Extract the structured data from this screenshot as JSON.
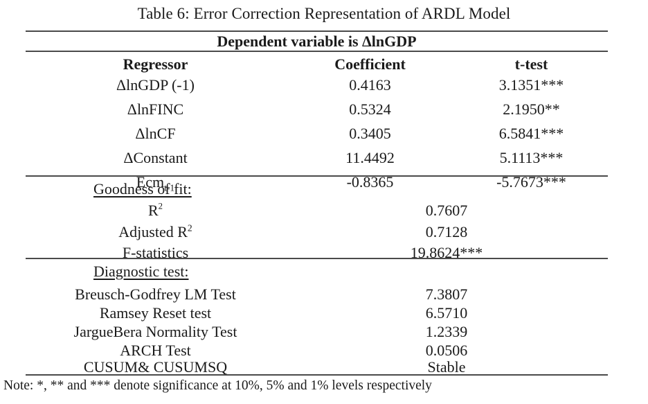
{
  "title": "Table 6: Error Correction Representation of ARDL Model",
  "dependent_variable_banner": "Dependent variable is ΔlnGDP",
  "columns": {
    "regressor": "Regressor",
    "coefficient": "Coefficient",
    "t_test": "t-test"
  },
  "regressors": [
    {
      "name": "ΔlnGDP (-1)",
      "coefficient": "0.4163",
      "t_test": "3.1351***"
    },
    {
      "name": "ΔlnFINC",
      "coefficient": "0.5324",
      "t_test": "2.1950**"
    },
    {
      "name": "ΔlnCF",
      "coefficient": "0.3405",
      "t_test": "6.5841***"
    },
    {
      "name": "ΔConstant",
      "coefficient": "11.4492",
      "t_test": "5.1113***"
    },
    {
      "name": "Ecm",
      "name_sub": "t-1",
      "coefficient": "-0.8365",
      "t_test": "-5.7673***"
    }
  ],
  "goodness_of_fit": {
    "heading": "Goodness of fit:",
    "rows": [
      {
        "label": "R",
        "label_sup": "2",
        "value": "0.7607"
      },
      {
        "label": "Adjusted R",
        "label_sup": "2",
        "value": "0.7128"
      },
      {
        "label": "F-statistics",
        "value": "19.8624***"
      }
    ]
  },
  "diagnostic_test": {
    "heading": "Diagnostic test:",
    "rows": [
      {
        "label": "Breusch-Godfrey LM Test",
        "value": "7.3807"
      },
      {
        "label": "Ramsey Reset test",
        "value": "6.5710"
      },
      {
        "label": "JargueBera Normality Test",
        "value": "1.2339"
      },
      {
        "label": "ARCH Test",
        "value": "0.0506"
      },
      {
        "label": "CUSUM& CUSUMSQ",
        "value": "Stable"
      }
    ]
  },
  "note": "Note: *, ** and *** denote significance at 10%, 5% and 1% levels respectively",
  "colors": {
    "text": "#1a1a1a",
    "rule": "#4a4a4a",
    "background": "#ffffff"
  }
}
